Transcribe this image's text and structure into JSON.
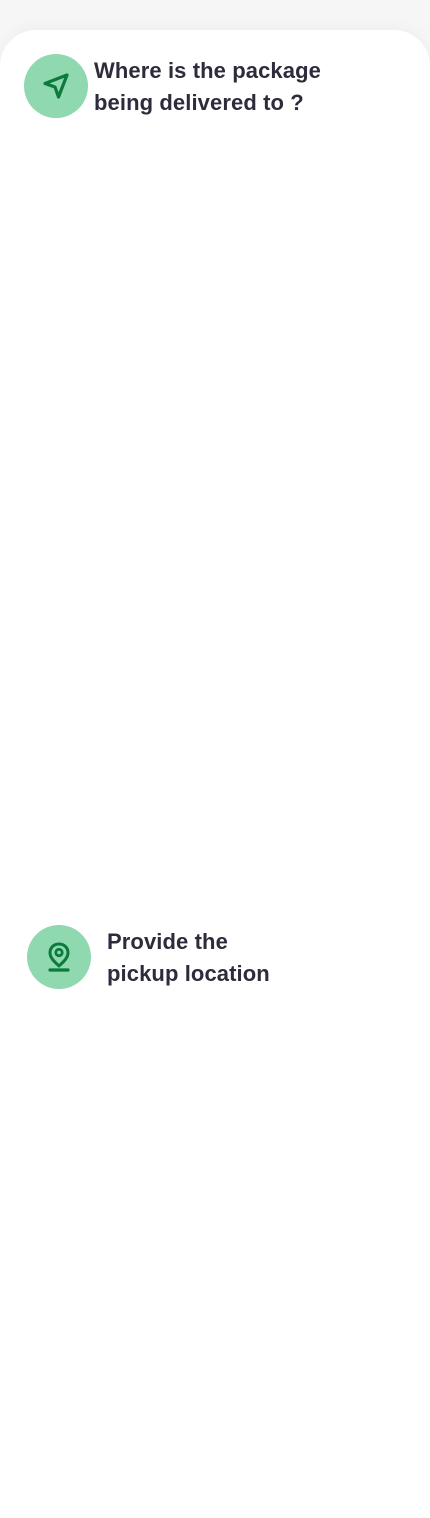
{
  "colors": {
    "icon_badge_bg": "#8fd8b0",
    "icon_fg": "#0b7a3b",
    "title_text": "#2c2c3c",
    "sheet_bg": "#ffffff"
  },
  "dropoff": {
    "icon": "navigation-arrow-icon",
    "title_line1": "Where is the package",
    "title_line2": "being delivered to ?"
  },
  "pickup": {
    "icon": "location-pin-icon",
    "title_line1": "Provide the",
    "title_line2": "pickup location"
  }
}
